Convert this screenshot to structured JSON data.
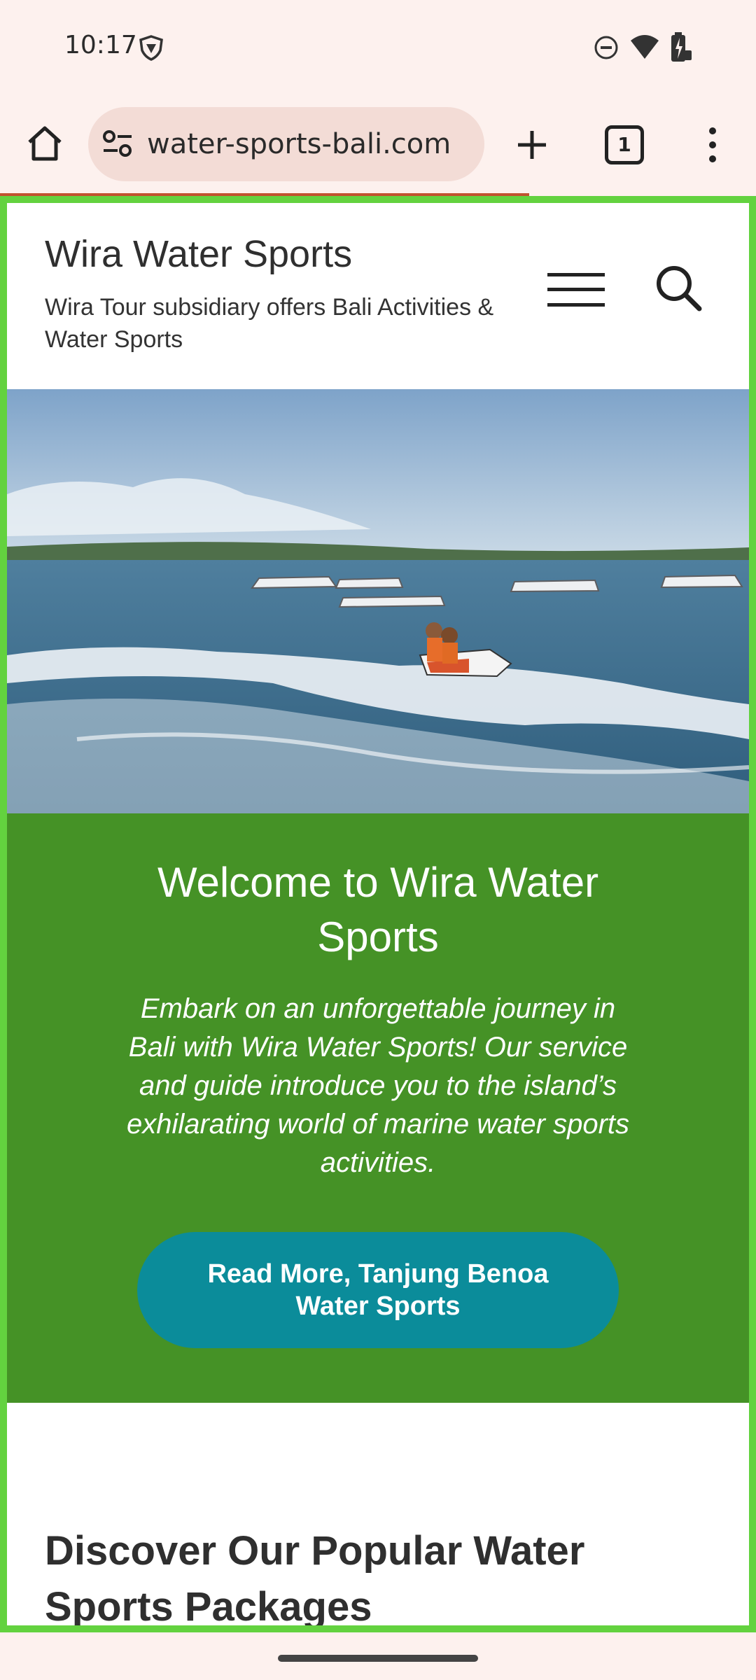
{
  "status_bar": {
    "time": "10:17",
    "icons": [
      "vpn-shield-icon",
      "do-not-disturb-icon",
      "wifi-icon",
      "battery-icon"
    ]
  },
  "browser": {
    "url": "water-sports-bali.com",
    "tab_count": "1",
    "icons": [
      "home-icon",
      "site-settings-icon",
      "new-tab-icon",
      "tab-switcher-icon",
      "more-menu-icon"
    ],
    "accent_color": "#c0522e"
  },
  "site": {
    "title": "Wira Water Sports",
    "tagline": "Wira Tour subsidiary offers Bali Activities & Water Sports"
  },
  "hero": {
    "image": "jet-ski-on-sea-photo"
  },
  "welcome": {
    "title": "Welcome to Wira Water Sports",
    "text": "Embark on an unforgettable journey in Bali with Wira Water Sports! Our service and guide introduce you to the island’s exhilarating world of marine water sports activities.",
    "button_label": "Read More, Tanjung Benoa Water Sports",
    "background_color": "#459226",
    "button_color": "#0b8c9a"
  },
  "packages": {
    "heading": "Discover Our Popular Water Sports Packages"
  },
  "colors": {
    "viewport_border": "#63d23f",
    "chrome_background": "#fdf1ee"
  }
}
